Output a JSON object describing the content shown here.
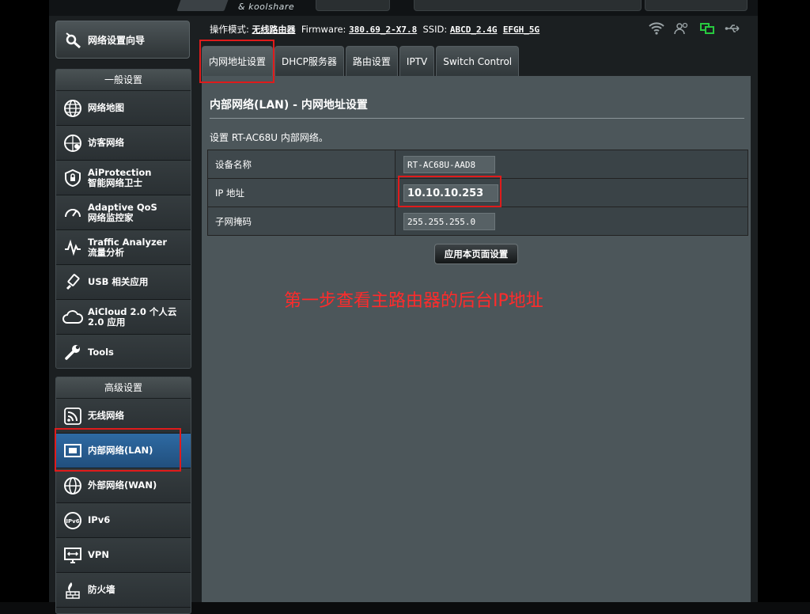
{
  "header": {
    "logo_sub": "& koolshare"
  },
  "wizard": {
    "label": "网络设置向导",
    "icon": "wizard-icon"
  },
  "general": {
    "title": "一般设置",
    "items": [
      {
        "label": "网络地图",
        "icon": "globe-icon"
      },
      {
        "label": "访客网络",
        "icon": "guest-network-icon"
      },
      {
        "label": "AiProtection\n智能网络卫士",
        "icon": "shield-lock-icon"
      },
      {
        "label": "Adaptive QoS\n网络监控家",
        "icon": "speedometer-icon"
      },
      {
        "label": "Traffic Analyzer\n流量分析",
        "icon": "traffic-icon"
      },
      {
        "label": "USB 相关应用",
        "icon": "usb-icon"
      },
      {
        "label": "AiCloud 2.0 个人云\n2.0 应用",
        "icon": "cloud-icon"
      },
      {
        "label": "Tools",
        "icon": "wrench-icon"
      }
    ]
  },
  "advanced": {
    "title": "高级设置",
    "items": [
      {
        "label": "无线网络",
        "icon": "wireless-icon"
      },
      {
        "label": "内部网络(LAN)",
        "icon": "lan-icon"
      },
      {
        "label": "外部网络(WAN)",
        "icon": "wan-globe-icon"
      },
      {
        "label": "IPv6",
        "icon": "ipv6-icon"
      },
      {
        "label": "VPN",
        "icon": "vpn-icon"
      },
      {
        "label": "防火墙",
        "icon": "firewall-icon"
      }
    ]
  },
  "info": {
    "mode_label": "操作模式:",
    "mode_value": "无线路由器",
    "firmware_label": "Firmware:",
    "firmware_value": "380.69_2-X7.8",
    "ssid_label": "SSID:",
    "ssid_24": "ABCD_2.4G",
    "ssid_5": "EFGH_5G"
  },
  "tabs": [
    "内网地址设置",
    "DHCP服务器",
    "路由设置",
    "IPTV",
    "Switch Control"
  ],
  "panel": {
    "title": "内部网络(LAN) - 内网地址设置",
    "desc": "设置 RT-AC68U 内部网络。",
    "fields": [
      {
        "label": "设备名称",
        "value": "RT-AC68U-AAD8"
      },
      {
        "label": "IP 地址",
        "value": "10.10.10.253"
      },
      {
        "label": "子网掩码",
        "value": "255.255.255.0"
      }
    ],
    "apply": "应用本页面设置"
  },
  "annotation": "第一步查看主路由器的后台IP地址",
  "colors": {
    "accent_red": "#e01b1b",
    "active_blue": "#2e6aa3",
    "panel": "#4c565a"
  }
}
